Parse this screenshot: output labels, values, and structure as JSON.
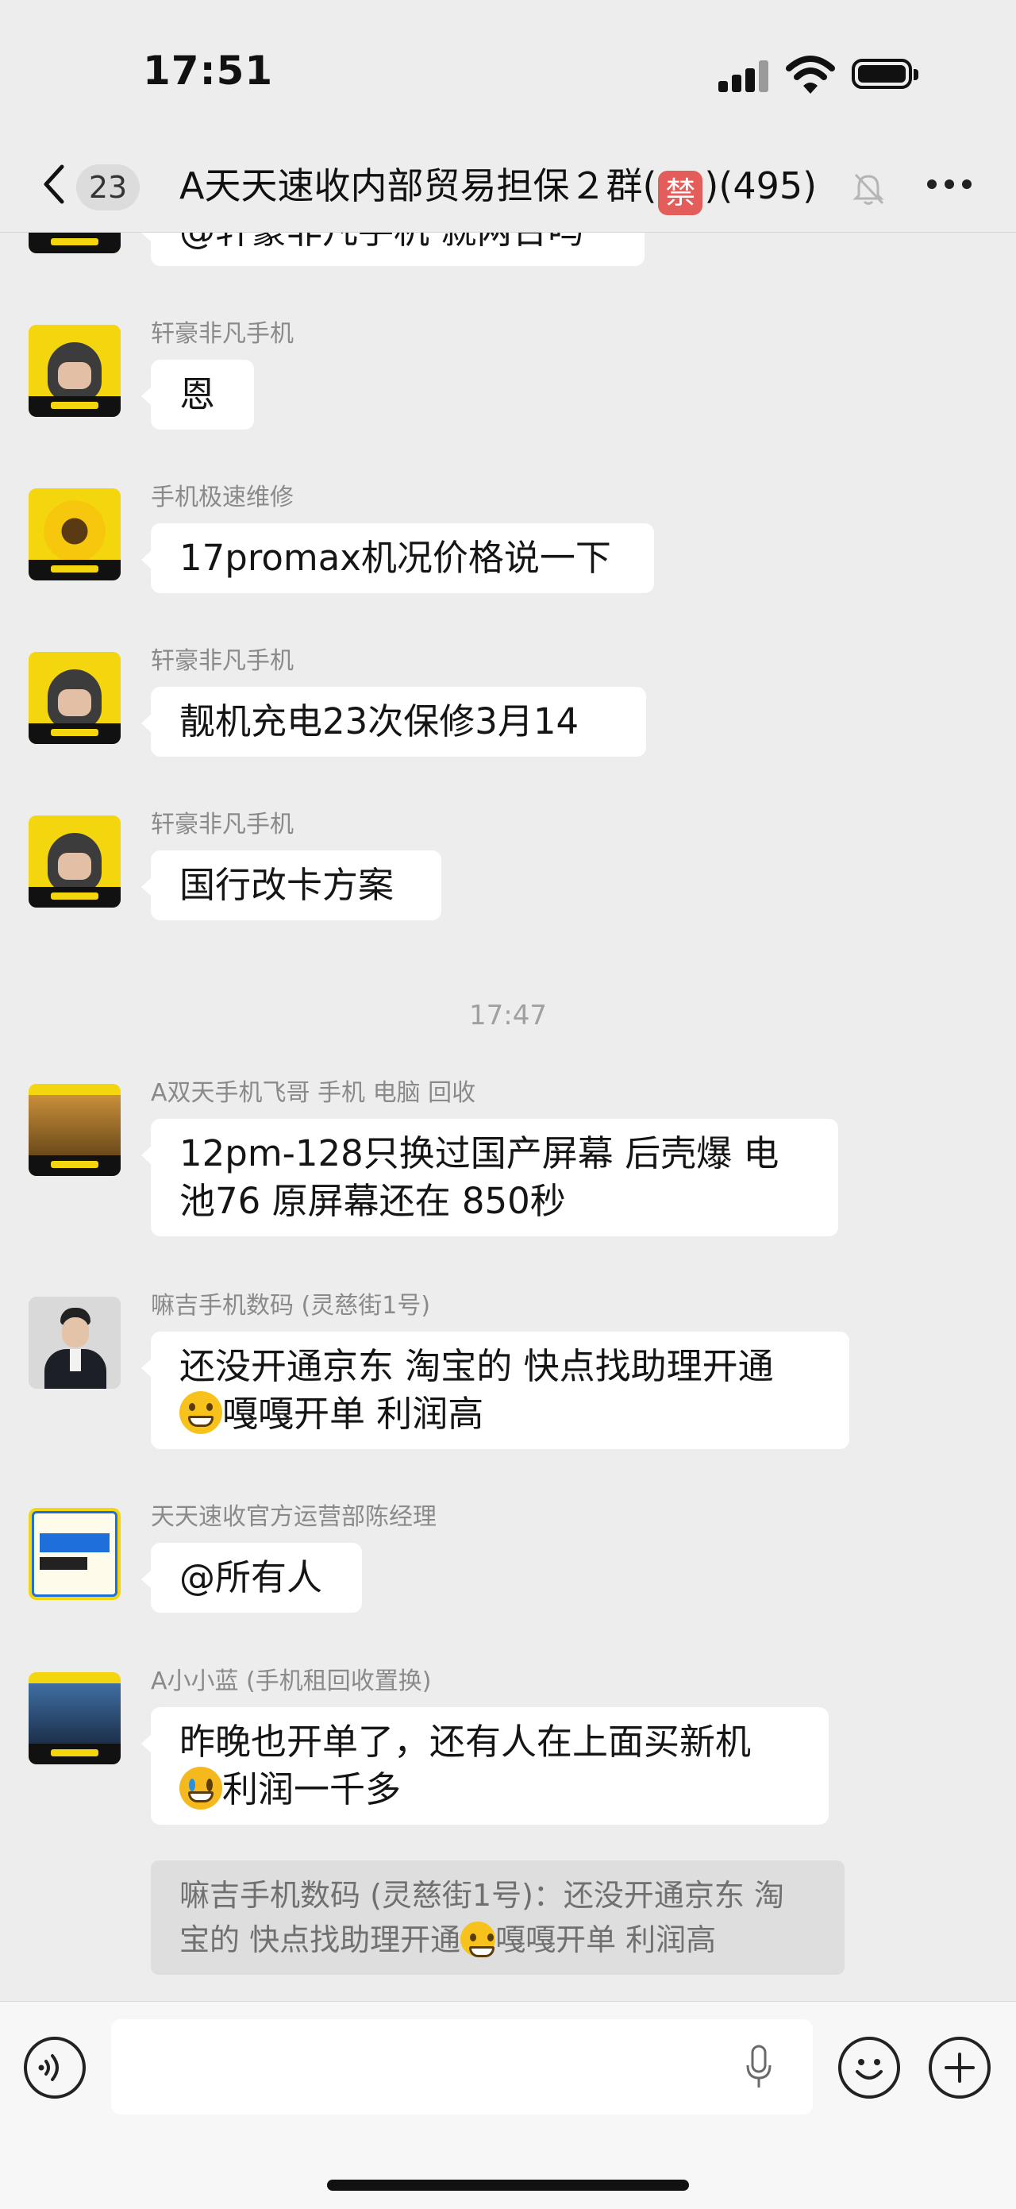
{
  "status_bar": {
    "time": "17:51"
  },
  "header": {
    "unread_count": "23",
    "title_prefix": "A天天速收内部贸易担保２群(",
    "banned_emoji": "禁",
    "title_suffix": ")(495)"
  },
  "messages": [
    {
      "sender": "",
      "text": "@轩豪非凡手机 就两台吗",
      "avatar": "tiantian-su-shou-avatar"
    },
    {
      "sender": "轩豪非凡手机",
      "text": "恩",
      "avatar": "tiantian-su-shou-avatar"
    },
    {
      "sender": "手机极速维修",
      "text": "17promax机况价格说一下",
      "avatar": "sunflower-avatar"
    },
    {
      "sender": "轩豪非凡手机",
      "text": "靓机充电23次保修3月14",
      "avatar": "tiantian-su-shou-avatar"
    },
    {
      "sender": "轩豪非凡手机",
      "text": "国行改卡方案",
      "avatar": "tiantian-su-shou-avatar"
    }
  ],
  "timestamp": "17:47",
  "messages_after": [
    {
      "sender": "A双天手机飞哥 手机 电脑 回收",
      "lines": [
        "12pm-128只换过国产屏幕 后壳爆 电",
        "池76  原屏幕还在   850秒"
      ]
    },
    {
      "sender": "嘛吉手机数码 (灵慈街1号)",
      "lines": [
        "还没开通京东 淘宝的 快点找助理开通",
        "嘎嘎开单 利润高"
      ]
    },
    {
      "sender": "天天速收官方运营部陈经理",
      "text": "@所有人"
    },
    {
      "sender": "A小小蓝 (手机租回收置换)",
      "lines": [
        "昨晚也开单了，还有人在上面买新机",
        "利润一千多"
      ]
    }
  ],
  "quote": {
    "line1": "嘛吉手机数码 (灵慈街1号)：还没开通京东 淘",
    "line2": "宝的 快点找助理开通",
    "line2_tail": "嘎嘎开单 利润高"
  },
  "input": {
    "placeholder": ""
  },
  "icons": {
    "back": "chevron-left-icon",
    "mute": "bell-slash-icon",
    "more": "ellipsis-icon",
    "voice": "voice-icon",
    "mic": "microphone-icon",
    "emoji": "smile-icon",
    "plus": "plus-icon"
  }
}
